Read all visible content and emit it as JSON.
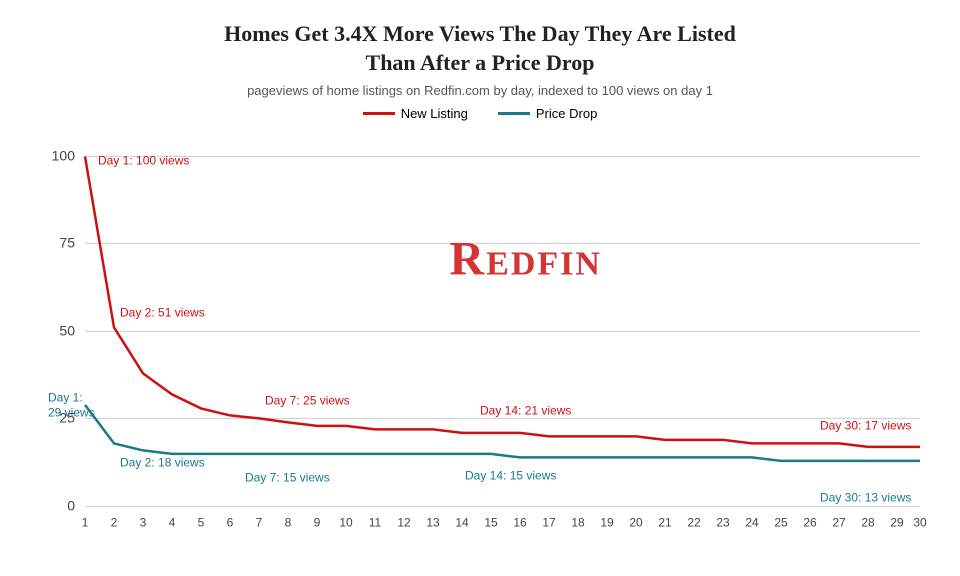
{
  "title": {
    "line1": "Homes Get 3.4X More Views The Day They Are Listed",
    "line2": "Than After a Price Drop"
  },
  "subtitle": "pageviews of home listings on Redfin.com by day, indexed to 100 views on day 1",
  "legend": {
    "new_listing_label": "New Listing",
    "price_drop_label": "Price Drop"
  },
  "redfin_logo": "Redfin",
  "colors": {
    "red": "#cc1111",
    "teal": "#1a7a8a",
    "grid": "#cccccc",
    "axis_text": "#444444"
  },
  "new_listing_annotations": [
    {
      "day": 1,
      "label": "Day 1: 100 views"
    },
    {
      "day": 2,
      "label": "Day 2: 51 views"
    },
    {
      "day": 7,
      "label": "Day 7: 25 views"
    },
    {
      "day": 14,
      "label": "Day 14: 21 views"
    },
    {
      "day": 30,
      "label": "Day 30: 17 views"
    }
  ],
  "price_drop_annotations": [
    {
      "day": 1,
      "label": "Day 1:\n29 views"
    },
    {
      "day": 2,
      "label": "Day 2: 18 views"
    },
    {
      "day": 7,
      "label": "Day 7: 15 views"
    },
    {
      "day": 14,
      "label": "Day 14: 15 views"
    },
    {
      "day": 30,
      "label": "Day 30: 13 views"
    }
  ],
  "y_axis": [
    0,
    25,
    50,
    75,
    100
  ],
  "x_axis": [
    1,
    2,
    3,
    4,
    5,
    6,
    7,
    8,
    9,
    10,
    11,
    12,
    13,
    14,
    15,
    16,
    17,
    18,
    19,
    20,
    21,
    22,
    23,
    24,
    25,
    26,
    27,
    28,
    29,
    30
  ]
}
